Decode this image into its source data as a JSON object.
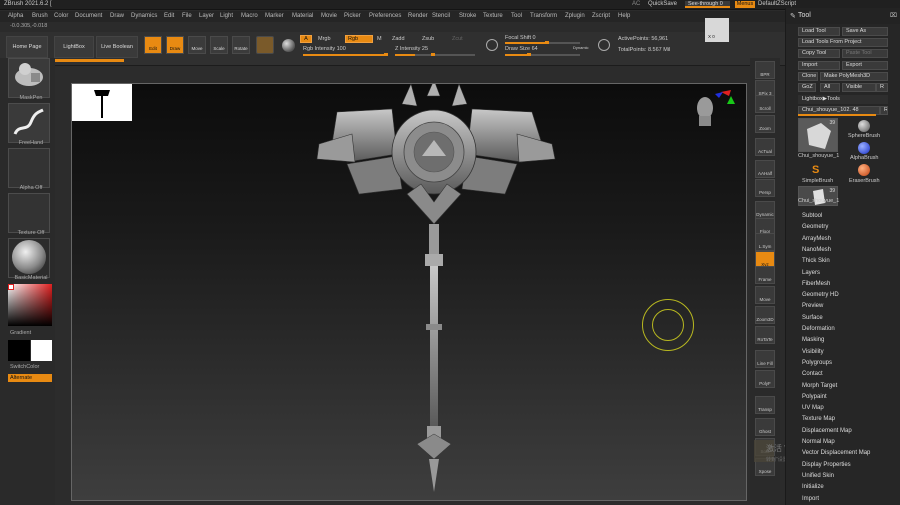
{
  "titlebar": {
    "title": "ZBrush 2021.6.2 [",
    "ac": "AC",
    "quicksave": "QuickSave",
    "see_through": "See-through  0",
    "menus": "Menus",
    "default_zscript": "DefaultZScript"
  },
  "menubar": [
    "Alpha",
    "Brush",
    "Color",
    "Document",
    "Draw",
    "Dynamics",
    "Edit",
    "File",
    "Layer",
    "Light",
    "Macro",
    "Marker",
    "Material",
    "Movie",
    "Picker",
    "Preferences",
    "Render",
    "Stencil",
    "Stroke",
    "Texture",
    "Tool",
    "Transform",
    "Zplugin",
    "Zscript",
    "Help"
  ],
  "coords": "-0.0.305,-0.018",
  "shelf": {
    "home_page": "Home Page",
    "lightbox": "LightBox",
    "live_boolean": "Live Boolean",
    "edit": "Edit",
    "draw": "Draw",
    "move": "Move",
    "scale": "Scale",
    "rotate": "Rotate",
    "a_btn": "A",
    "mrgb": "Mrgb",
    "rgb": "Rgb",
    "m": "M",
    "zadd": "Zadd",
    "zsub": "Zsub",
    "zcut": "Zcut",
    "rgb_intensity": "Rgb Intensity 100",
    "z_intensity": "Z Intensity 25",
    "focal_shift": "Focal Shift 0",
    "draw_size": "Draw Size 64",
    "dynamic": "Dynamic",
    "active_points": "ActivePoints: 56,961",
    "total_points": "TotalPoints: 8.567 Mil",
    "corner_value": "X 0"
  },
  "lefttray": {
    "maskpen": "MaskPen",
    "freehand": "FreeHand",
    "alpha_off": "Alpha Off",
    "texture_off": "Texture Off",
    "basic_material": "BasicMaterial",
    "gradient": "Gradient",
    "switch_color": "SwitchColor",
    "alternate": "Alternate"
  },
  "rightshelf": [
    {
      "id": "bpr",
      "label": "BPR"
    },
    {
      "id": "spix",
      "label": "SPix 3"
    },
    {
      "id": "scroll",
      "label": "Scroll"
    },
    {
      "id": "zoom",
      "label": "Zoom"
    },
    {
      "id": "actual",
      "label": "AcTual"
    },
    {
      "id": "aahalf",
      "label": "AAHalf"
    },
    {
      "id": "persp",
      "label": "Persp"
    },
    {
      "id": "dynamic",
      "label": "Dynamic"
    },
    {
      "id": "floor",
      "label": "Floor"
    },
    {
      "id": "lsym",
      "label": "L.Sym"
    },
    {
      "id": "xyz",
      "label": "Xyz"
    },
    {
      "id": "frame",
      "label": "Frame"
    },
    {
      "id": "move",
      "label": "Move"
    },
    {
      "id": "zoom3d",
      "label": "Zoom3D"
    },
    {
      "id": "rotate",
      "label": "RoTaTe"
    },
    {
      "id": "linefill",
      "label": "Line Fill"
    },
    {
      "id": "polyf",
      "label": "PolyF"
    },
    {
      "id": "transp",
      "label": "Transp"
    },
    {
      "id": "ghost",
      "label": "Ghost"
    },
    {
      "id": "solo",
      "label": "Solo"
    },
    {
      "id": "xpose",
      "label": "Xpose"
    }
  ],
  "watermark": {
    "line1": "激活 Windows",
    "line2": "转到\"设置\"以激活 Windows。"
  },
  "toolpanel": {
    "title": "Tool",
    "load_tool": "Load Tool",
    "save_as": "Save As",
    "load_from_project": "Load Tools From Project",
    "copy_tool": "Copy Tool",
    "paste_tool": "Paste Tool",
    "import": "Import",
    "export": "Export",
    "clone": "Clone",
    "make_polymesh": "Make PolyMesh3D",
    "goz": "GoZ",
    "all": "All",
    "visible": "Visible",
    "r": "R",
    "lightbox_tools": "Lightbox▶Tools",
    "current_tool": "Chui_shouyue_102. 48",
    "thumbs": [
      {
        "label": "Chui_shouyue_1",
        "badge": "39"
      },
      {
        "label": "SphereBrush",
        "badge": ""
      },
      {
        "label": "AlphaBrush",
        "badge": ""
      },
      {
        "label": "SimpleBrush",
        "badge": ""
      },
      {
        "label": "EraserBrush",
        "badge": ""
      },
      {
        "label": "Chui_shouyue_1",
        "badge": "39"
      }
    ],
    "subpalettes": [
      "Subtool",
      "Geometry",
      "ArrayMesh",
      "NanoMesh",
      "Thick Skin",
      "Layers",
      "FiberMesh",
      "Geometry HD",
      "Preview",
      "Surface",
      "Deformation",
      "Masking",
      "Visibility",
      "Polygroups",
      "Contact",
      "Morph Target",
      "Polypaint",
      "UV Map",
      "Texture Map",
      "Displacement Map",
      "Normal Map",
      "Vector Displacement Map",
      "Display Properties",
      "Unified Skin",
      "Initialize",
      "Import"
    ]
  }
}
